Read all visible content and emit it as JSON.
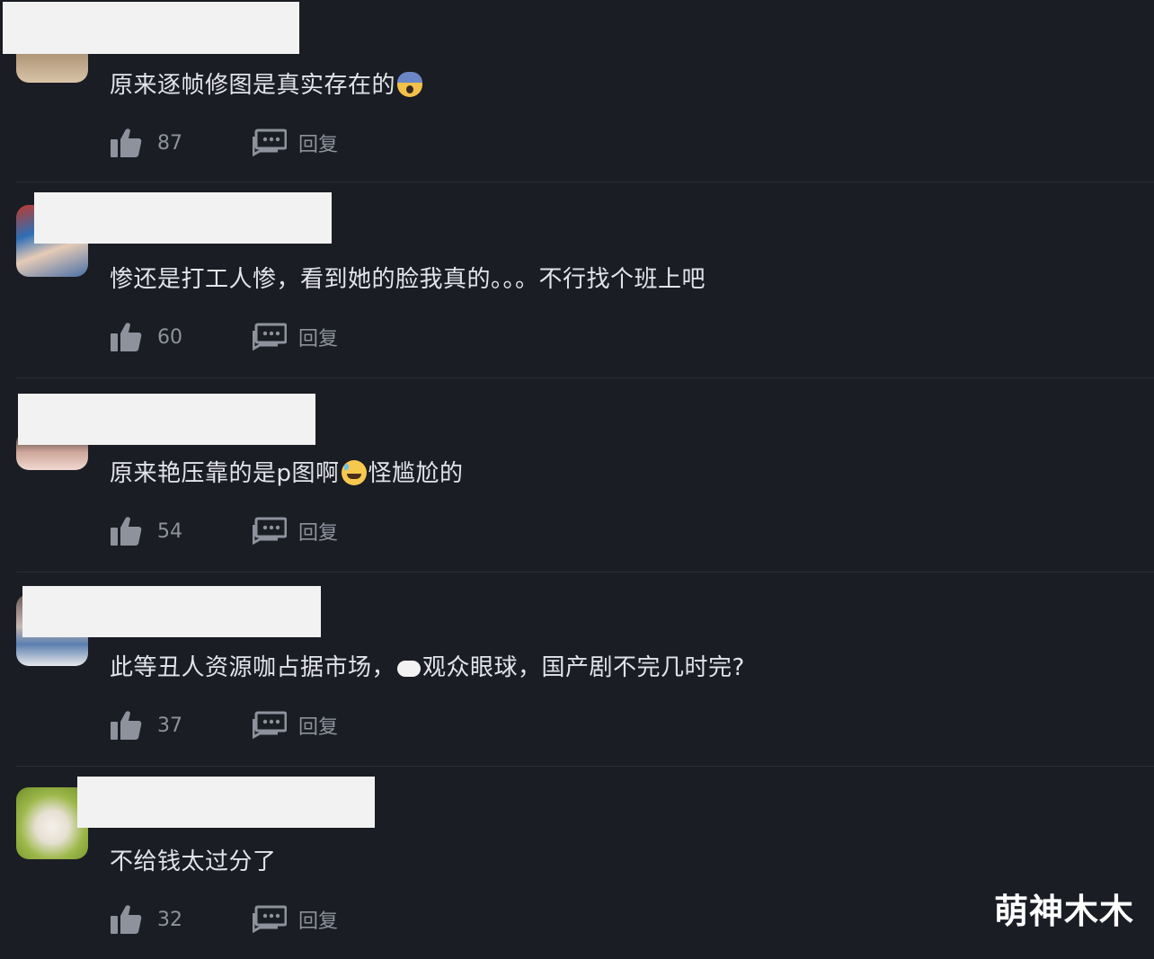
{
  "comments": [
    {
      "text_a": "原来逐帧修图是真实存在的",
      "emoji_a": "fearful-face",
      "text_b": "",
      "emoji_b": "",
      "text_c": "",
      "likes": "87",
      "reply": "回复"
    },
    {
      "text_a": "惨还是打工人惨，看到她的脸我真的。。。不行找个班上吧",
      "emoji_a": "",
      "text_b": "",
      "emoji_b": "",
      "text_c": "",
      "likes": "60",
      "reply": "回复"
    },
    {
      "text_a": "原来艳压靠的是p图啊",
      "emoji_a": "sweat-smile",
      "text_b": "怪尴尬的",
      "emoji_b": "",
      "text_c": "",
      "likes": "54",
      "reply": "回复"
    },
    {
      "text_a": "此等丑人资源咖占据市场，",
      "emoji_a": "",
      "text_b": "观众眼球，国产剧不完几时完?",
      "emoji_b": "",
      "text_c": "",
      "likes": "37",
      "reply": "回复"
    },
    {
      "text_a": "不给钱太过分了",
      "emoji_a": "",
      "text_b": "",
      "emoji_b": "",
      "text_c": "",
      "likes": "32",
      "reply": "回复"
    }
  ],
  "watermark": "萌神木木",
  "colors": {
    "background": "#1b1d24",
    "text": "#e2e4e9",
    "muted": "#8e929c",
    "mask": "#f2f2f3"
  }
}
